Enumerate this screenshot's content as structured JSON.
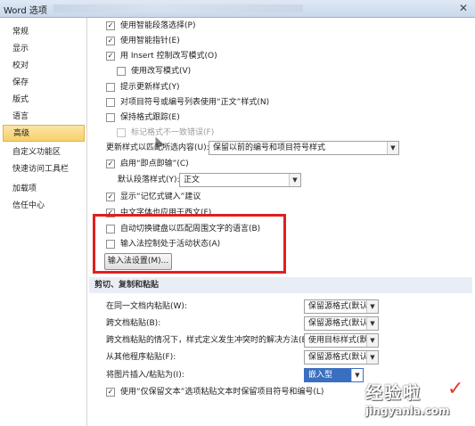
{
  "window": {
    "title": "Word 选项",
    "close": "✕"
  },
  "sidebar": {
    "items": [
      {
        "label": "常规"
      },
      {
        "label": "显示"
      },
      {
        "label": "校对"
      },
      {
        "label": "保存"
      },
      {
        "label": "版式"
      },
      {
        "label": "语言"
      },
      {
        "label": "高级",
        "active": true
      },
      {
        "label": "自定义功能区"
      },
      {
        "label": "快速访问工具栏"
      },
      {
        "label": "加载项"
      },
      {
        "label": "信任中心"
      }
    ]
  },
  "editing": {
    "opt1": "使用智能段落选择(P)",
    "opt2": "使用智能指针(E)",
    "opt3": "用 Insert 控制改写模式(O)",
    "opt4": "使用改写模式(V)",
    "opt5": "提示更新样式(Y)",
    "opt6": "对项目符号或编号列表使用“正文”样式(N)",
    "opt7": "保持格式跟踪(E)",
    "opt8": "标记格式不一致错误(F)",
    "update_label": "更新样式以匹配所选内容(U):",
    "update_value": "保留以前的编号和项目符号样式",
    "clickntype": "启用“即点即输”(C)",
    "default_para_label": "默认段落样式(Y):",
    "default_para_value": "正文",
    "autocomplete": "显示“记忆式键入”建议",
    "cjk_font": "中文字体也应用于西文(F)",
    "ime_switch": "自动切换键盘以匹配周围文字的语言(B)",
    "ime_active": "输入法控制处于活动状态(A)",
    "ime_settings": "输入法设置(M)..."
  },
  "paste": {
    "header": "剪切、复制和粘贴",
    "rows": [
      {
        "label": "在同一文档内粘贴(W):",
        "value": "保留源格式(默认)"
      },
      {
        "label": "跨文档粘贴(B):",
        "value": "保留源格式(默认)"
      },
      {
        "label": "跨文档粘贴的情况下，样式定义发生冲突时的解决方法(E):",
        "value": "使用目标样式(默认)"
      },
      {
        "label": "从其他程序粘贴(F):",
        "value": "保留源格式(默认)"
      },
      {
        "label": "将图片插入/粘贴为(I):",
        "value": "嵌入型"
      }
    ],
    "keep_bullets": "使用“仅保留文本”选项粘贴文本时保留项目符号和编号(L)"
  },
  "watermark": {
    "line1": "经验啦",
    "line2": "jingyanla.com",
    "check": "✓"
  }
}
